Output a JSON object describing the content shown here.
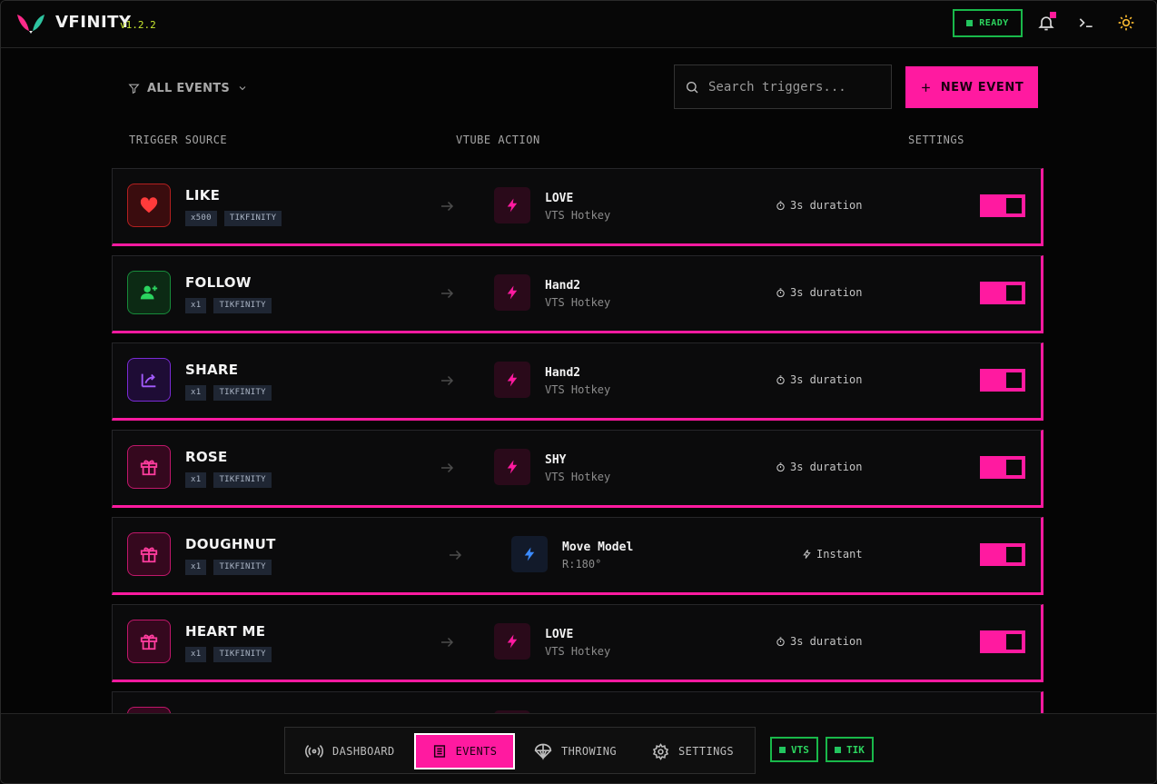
{
  "app": {
    "name": "VFINITY",
    "version": "v1.2.2",
    "status": "READY"
  },
  "colors": {
    "accent": "#ff1aa0",
    "ok": "#22c55e"
  },
  "toolbar": {
    "filter_label": "ALL EVENTS",
    "search_placeholder": "Search triggers...",
    "new_event_label": "NEW EVENT"
  },
  "columns": {
    "source": "TRIGGER SOURCE",
    "action": "VTUBE ACTION",
    "settings": "SETTINGS"
  },
  "events": [
    {
      "name": "LIKE",
      "icon": "heart-icon",
      "count": "x500",
      "source_tag": "TIKFINITY",
      "action_name": "LOVE",
      "action_type": "VTS Hotkey",
      "action_icon": "bolt-icon",
      "timing": "3s duration",
      "enabled": true
    },
    {
      "name": "FOLLOW",
      "icon": "user-plus-icon",
      "count": "x1",
      "source_tag": "TIKFINITY",
      "action_name": "Hand2",
      "action_type": "VTS Hotkey",
      "action_icon": "bolt-icon",
      "timing": "3s duration",
      "enabled": true
    },
    {
      "name": "SHARE",
      "icon": "share-icon",
      "count": "x1",
      "source_tag": "TIKFINITY",
      "action_name": "Hand2",
      "action_type": "VTS Hotkey",
      "action_icon": "bolt-icon",
      "timing": "3s duration",
      "enabled": true
    },
    {
      "name": "ROSE",
      "icon": "gift-icon",
      "count": "x1",
      "source_tag": "TIKFINITY",
      "action_name": "SHY",
      "action_type": "VTS Hotkey",
      "action_icon": "bolt-icon",
      "timing": "3s duration",
      "enabled": true
    },
    {
      "name": "DOUGHNUT",
      "icon": "gift-icon",
      "count": "x1",
      "source_tag": "TIKFINITY",
      "action_name": "Move Model",
      "action_type": "R:180°",
      "action_icon": "bolt-icon",
      "timing": "Instant",
      "enabled": true
    },
    {
      "name": "HEART ME",
      "icon": "gift-icon",
      "count": "x1",
      "source_tag": "TIKFINITY",
      "action_name": "LOVE",
      "action_type": "VTS Hotkey",
      "action_icon": "bolt-icon",
      "timing": "3s duration",
      "enabled": true
    }
  ],
  "nav": {
    "dashboard": "DASHBOARD",
    "events": "EVENTS",
    "throwing": "THROWING",
    "settings": "SETTINGS",
    "active": "EVENTS"
  },
  "connections": {
    "vts": "VTS",
    "tik": "TIK"
  }
}
